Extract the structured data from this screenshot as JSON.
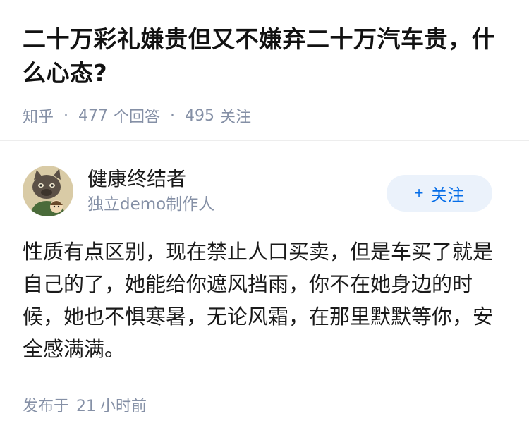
{
  "question": {
    "title": "二十万彩礼嫌贵但又不嫌弃二十万汽车贵，什么心态?",
    "source": "知乎",
    "answer_count": "477",
    "answer_label": "个回答",
    "follow_count": "495",
    "follow_label": "关注",
    "separator": "·"
  },
  "answer": {
    "author_name": "健康终结者",
    "author_bio": "独立demo制作人",
    "follow_button": {
      "icon": "+",
      "label": "关注"
    },
    "content": "性质有点区别，现在禁止人口买卖，但是车买了就是自己的了，她能给你遮风挡雨，你不在她身边的时候，她也不惧寒暑，无论风霜，在那里默默等你，安全感满满。",
    "posted_prefix": "发布于",
    "posted_num": "21",
    "posted_suffix": "小时前"
  },
  "colors": {
    "accent": "#056de8",
    "accent_bg": "#ebf2fb",
    "meta": "#8590a6"
  }
}
